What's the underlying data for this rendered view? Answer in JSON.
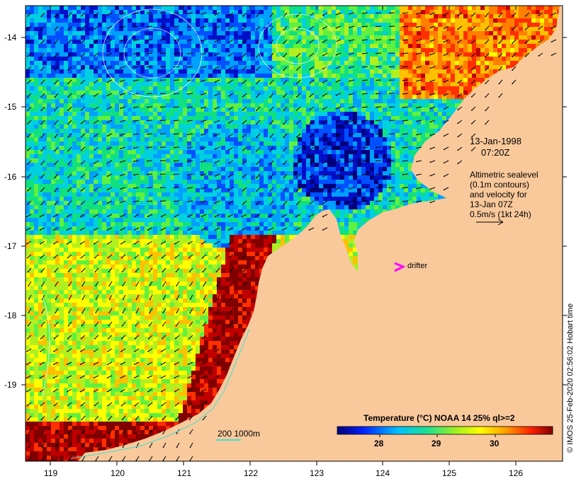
{
  "map": {
    "date_label": "13-Jan-1998",
    "time_label": "07:20Z",
    "annotation_lines": [
      "Altimetric sealevel",
      "(0.1m contours)",
      "and velocity for",
      "13-Jan 07Z",
      "0.5m/s (1kt 24h)"
    ],
    "drifter_label": "drifter",
    "bathy_label": "200  1000m",
    "colorbar_title": "Temperature (°C) NOAA 14 25% ql>=2",
    "colorbar_ticks": [
      "28",
      "29",
      "30"
    ],
    "copyright": "© IMOS 25-Feb-2020 02:56:02 Hobart time",
    "lon_ticks": [
      "119",
      "120",
      "121",
      "122",
      "123",
      "124",
      "125",
      "126"
    ],
    "lat_ticks": [
      "-14",
      "-15",
      "-16",
      "-17",
      "-18",
      "-19"
    ],
    "colors": {
      "land": "#f9c99c",
      "drifter": "#ff00ff",
      "contour": "#ffffff",
      "bathy": "#40e0d0"
    }
  }
}
